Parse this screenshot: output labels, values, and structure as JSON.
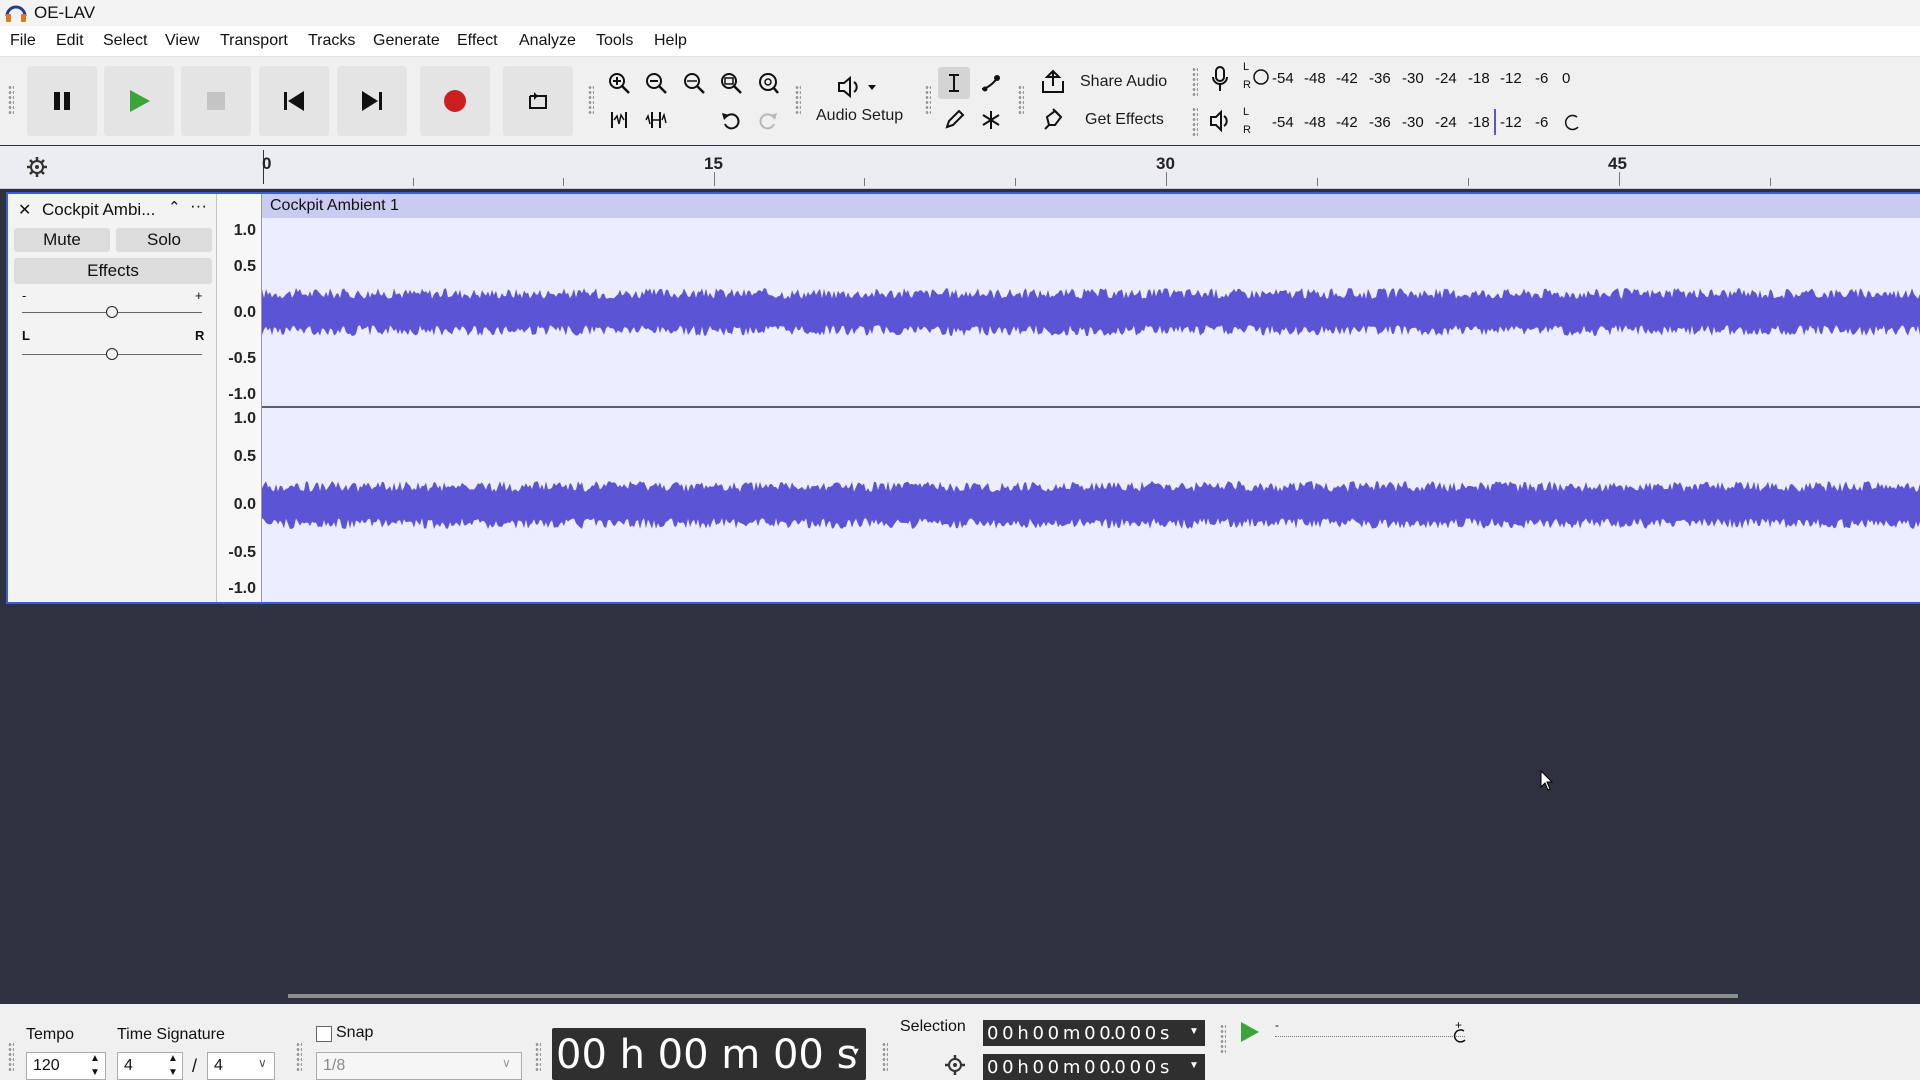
{
  "app": {
    "title": "OE-LAV"
  },
  "menu": [
    "File",
    "Edit",
    "Select",
    "View",
    "Transport",
    "Tracks",
    "Generate",
    "Effect",
    "Analyze",
    "Tools",
    "Help"
  ],
  "toolbar": {
    "audio_setup_label": "Audio Setup",
    "share_audio_label": "Share Audio",
    "get_effects_label": "Get Effects",
    "meter_scale": [
      "-54",
      "-48",
      "-42",
      "-36",
      "-30",
      "-24",
      "-18",
      "-12",
      "-6",
      "0"
    ],
    "playback_meter_scale": [
      "-54",
      "-48",
      "-42",
      "-36",
      "-30",
      "-24",
      "-18",
      "-12",
      "-6"
    ],
    "meter_l": "L",
    "meter_r": "R"
  },
  "timeline": {
    "ticks": [
      "0",
      "15",
      "30",
      "45"
    ]
  },
  "track": {
    "name": "Cockpit Ambi...",
    "clip_name": "Cockpit Ambient 1",
    "mute_label": "Mute",
    "solo_label": "Solo",
    "effects_label": "Effects",
    "gain_minus": "-",
    "gain_plus": "+",
    "pan_left": "L",
    "pan_right": "R",
    "scale_top": [
      "1.0",
      "0.5",
      "0.0",
      "-0.5",
      "-1.0"
    ],
    "scale_bottom": [
      "1.0",
      "0.5",
      "0.0",
      "-0.5",
      "-1.0"
    ]
  },
  "bottom": {
    "tempo_label": "Tempo",
    "tempo_value": "120",
    "timesig_label": "Time Signature",
    "timesig_num": "4",
    "timesig_sep": "/",
    "timesig_den": "4",
    "snap_label": "Snap",
    "snap_value": "1/8",
    "time_display": "00 h 00 m 00 s",
    "selection_label": "Selection",
    "selection_start": "0 0 h 0 0 m 0 0.0 0 0 s",
    "selection_end": "0 0 h 0 0 m 0 0.0 0 0 s"
  },
  "colors": {
    "waveform": "#5b55d6",
    "record": "#cc2020",
    "play": "#3aa43a",
    "background": "#2e3140"
  }
}
